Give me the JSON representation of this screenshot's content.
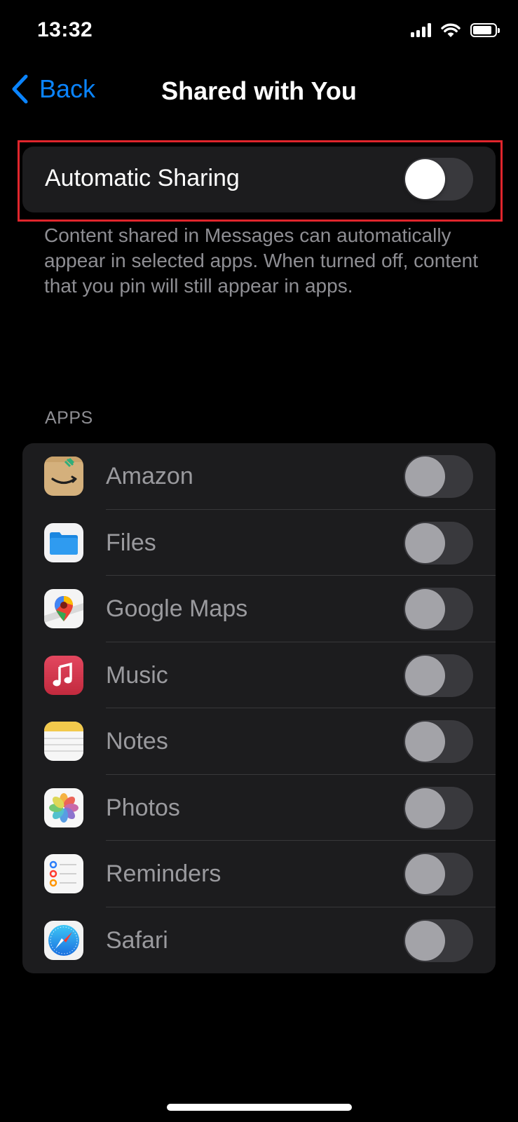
{
  "status_bar": {
    "time": "13:32",
    "icons": [
      "cellular-signal-icon",
      "wifi-icon",
      "battery-icon"
    ]
  },
  "nav": {
    "back_label": "Back",
    "title": "Shared with You"
  },
  "automatic_sharing": {
    "label": "Automatic Sharing",
    "enabled": false,
    "footnote": "Content shared in Messages can automatically appear in selected apps. When turned off, content that you pin will still appear in apps."
  },
  "apps_section": {
    "header": "APPS",
    "items": [
      {
        "label": "Amazon",
        "icon": "amazon-icon",
        "enabled": false
      },
      {
        "label": "Files",
        "icon": "files-icon",
        "enabled": false
      },
      {
        "label": "Google Maps",
        "icon": "google-maps-icon",
        "enabled": false
      },
      {
        "label": "Music",
        "icon": "music-icon",
        "enabled": false
      },
      {
        "label": "Notes",
        "icon": "notes-icon",
        "enabled": false
      },
      {
        "label": "Photos",
        "icon": "photos-icon",
        "enabled": false
      },
      {
        "label": "Reminders",
        "icon": "reminders-icon",
        "enabled": false
      },
      {
        "label": "Safari",
        "icon": "safari-icon",
        "enabled": false
      }
    ]
  },
  "colors": {
    "background": "#000000",
    "card": "#1c1c1e",
    "accent": "#0a84ff",
    "highlight": "#e0252c",
    "secondary_text": "#8e8e93",
    "toggle_off": "#39393d"
  }
}
